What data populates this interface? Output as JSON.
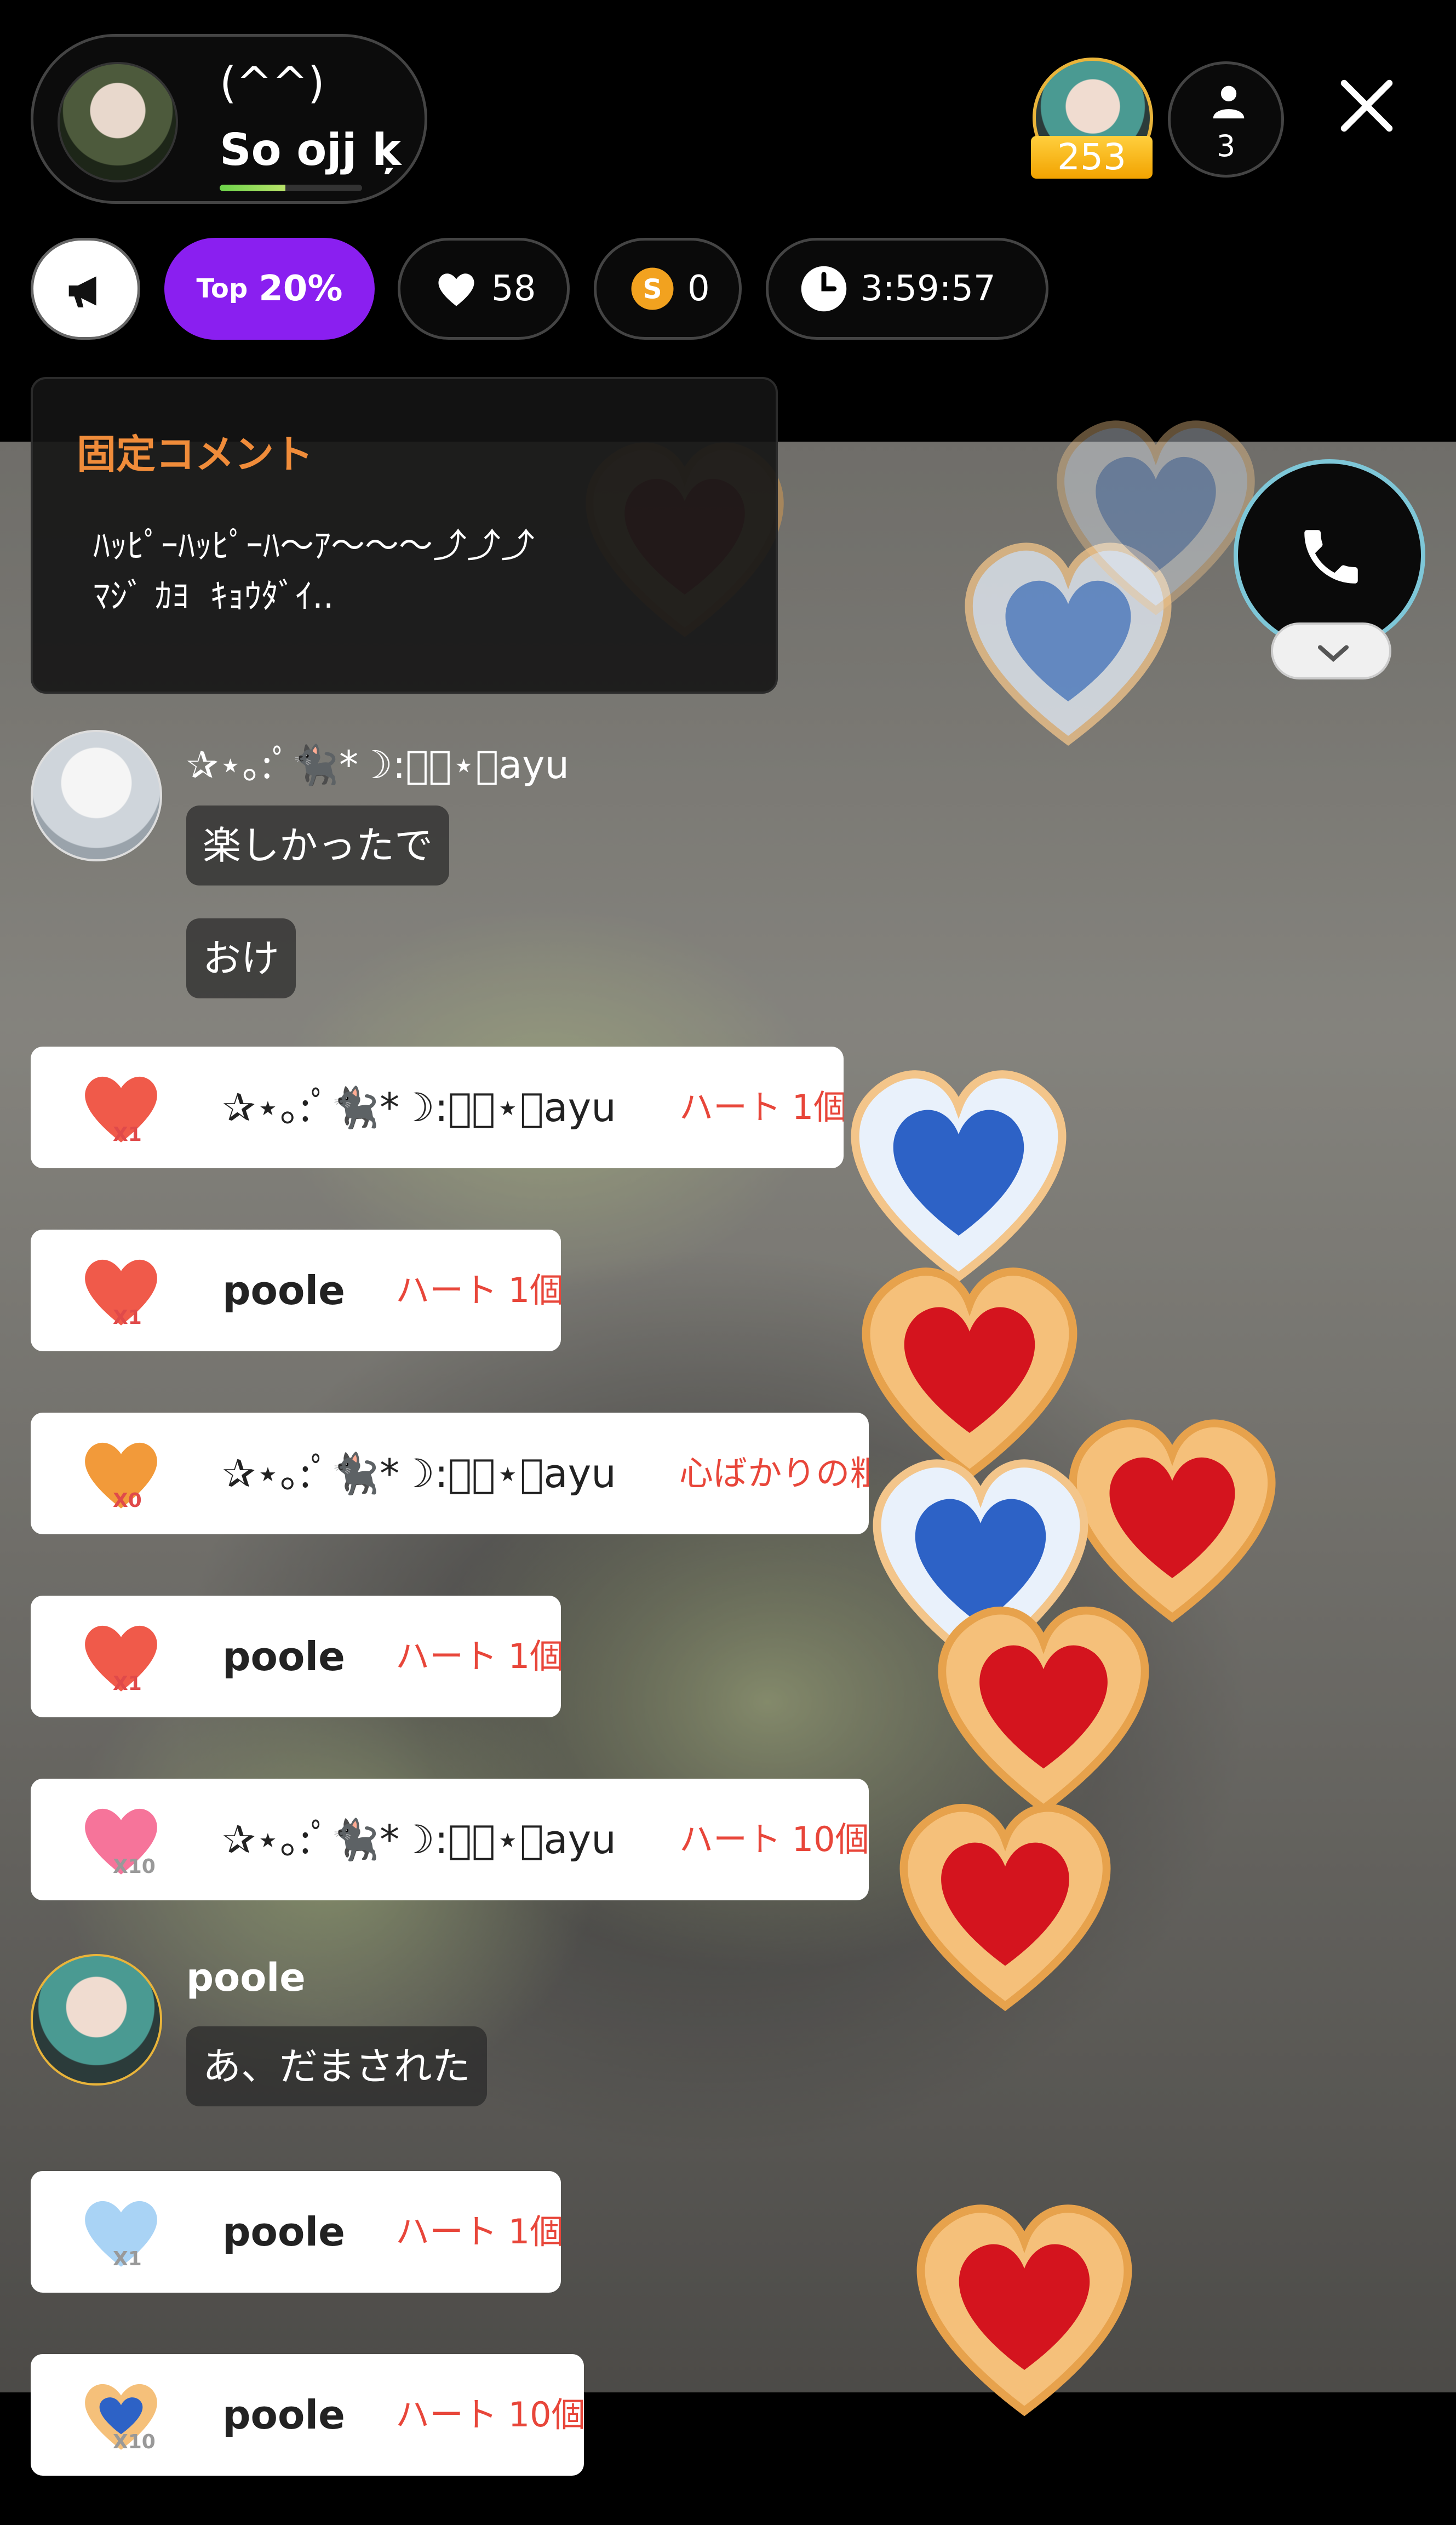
{
  "colors": {
    "accent_purple": "#8a1ff0",
    "pinned_orange": "#f08c3a",
    "gift_red": "#e8463a",
    "rank_gold": "#f2a300"
  },
  "host": {
    "subtitle": "(^^)",
    "name": "So ojj ķ"
  },
  "rank": {
    "badge": "253"
  },
  "viewers": {
    "count": "3"
  },
  "stats": {
    "top_small": "Top",
    "top_value": "20%",
    "hearts": "58",
    "coins": "0",
    "timer": "3:59:57"
  },
  "pinned": {
    "title": "固定コメント",
    "text": "ﾊｯﾋﾟｰﾊｯﾋﾟｰﾊ〜ｱ〜〜〜⤴⤴⤴\nﾏｼﾞ ｶﾖ  ｷｮｳﾀﾞｲ.."
  },
  "comments": [
    {
      "name": "✰⋆｡:ﾟ🐈‍⬛*☽:ﾟ･⋆｡ayu",
      "bubbles": [
        "楽しかったで",
        "おけ"
      ]
    },
    {
      "name": "poole",
      "bubbles": [
        "あ、だまされた"
      ]
    }
  ],
  "gifts": [
    {
      "mult": "X1",
      "name": "✰⋆｡:ﾟ🐈‍⬛*☽:ﾟ･⋆｡ayu",
      "desc": "ハート 1個"
    },
    {
      "mult": "X1",
      "name": "poole",
      "desc": "ハート 1個"
    },
    {
      "mult": "X0",
      "name": "✰⋆｡:ﾟ🐈‍⬛*☽:ﾟ･⋆｡ayu",
      "desc": "心ばかりの粗"
    },
    {
      "mult": "X1",
      "name": "poole",
      "desc": "ハート 1個"
    },
    {
      "mult": "X10",
      "name": "✰⋆｡:ﾟ🐈‍⬛*☽:ﾟ･⋆｡ayu",
      "desc": "ハート 10個"
    },
    {
      "mult": "X1",
      "name": "poole",
      "desc": "ハート 1個"
    },
    {
      "mult": "X10",
      "name": "poole",
      "desc": "ハート 10個"
    }
  ]
}
